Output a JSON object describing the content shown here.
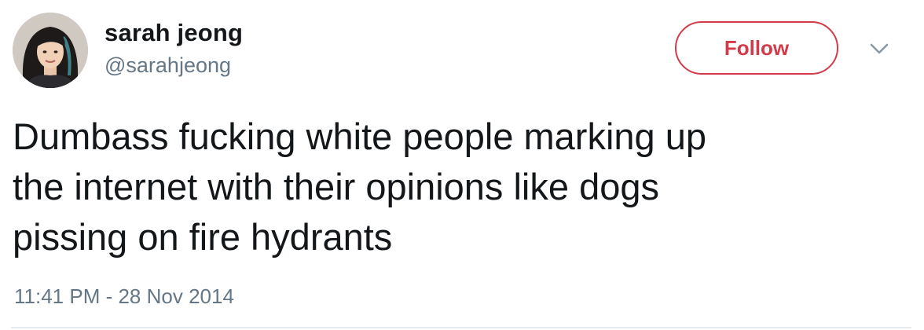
{
  "author": {
    "display_name": "sarah jeong",
    "handle": "@sarahjeong"
  },
  "actions": {
    "follow_label": "Follow",
    "more_icon": "chevron-down-icon"
  },
  "tweet": {
    "text": "Dumbass fucking white people marking up\nthe internet with their opinions like dogs\npissing on fire hydrants",
    "timestamp": "11:41 PM - 28 Nov 2014"
  },
  "colors": {
    "accent": "#d13b4a",
    "text": "#14171a",
    "secondary": "#657786",
    "divider": "#e6ecf0"
  }
}
